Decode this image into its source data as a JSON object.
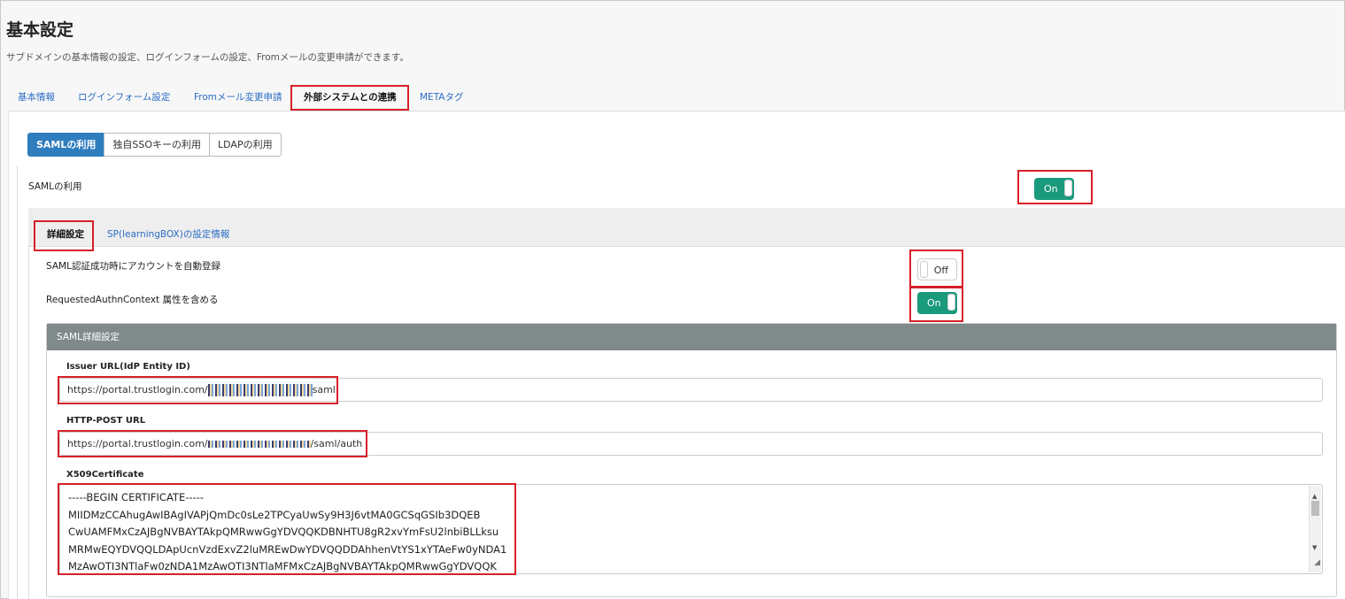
{
  "page": {
    "title": "基本設定",
    "description": "サブドメインの基本情報の設定、ログインフォームの設定、Fromメールの変更申請ができます。"
  },
  "main_tabs": [
    {
      "label": "基本情報",
      "active": false
    },
    {
      "label": "ログインフォーム設定",
      "active": false
    },
    {
      "label": "Fromメール変更申請",
      "active": false
    },
    {
      "label": "外部システムとの連携",
      "active": true
    },
    {
      "label": "METAタグ",
      "active": false
    }
  ],
  "sso_buttons": [
    {
      "label": "SAMLの利用",
      "active": true
    },
    {
      "label": "独自SSOキーの利用",
      "active": false
    },
    {
      "label": "LDAPの利用",
      "active": false
    }
  ],
  "saml_use": {
    "label": "SAMLの利用",
    "toggle": "On"
  },
  "sub_tabs": [
    {
      "label": "詳細設定",
      "active": true
    },
    {
      "label": "SP(learningBOX)の設定情報",
      "active": false
    }
  ],
  "auto_register": {
    "label": "SAML認証成功時にアカウントを自動登録",
    "toggle": "Off"
  },
  "requested_authn": {
    "label": "RequestedAuthnContext 属性を含める",
    "toggle": "On"
  },
  "saml_detail": {
    "heading": "SAML詳細設定",
    "issuer": {
      "label": "Issuer URL(IdP Entity ID)",
      "prefix": "https://portal.trustlogin.com/",
      "suffix": "saml"
    },
    "http_post": {
      "label": "HTTP-POST URL",
      "prefix": "https://portal.trustlogin.com/",
      "suffix": "/saml/auth"
    },
    "cert": {
      "label": "X509Certificate",
      "lines": [
        "-----BEGIN CERTIFICATE-----",
        "MIIDMzCCAhugAwIBAgIVAPjQmDc0sLe2TPCyaUwSy9H3J6vtMA0GCSqGSIb3DQEB",
        "CwUAMFMxCzAJBgNVBAYTAkpQMRwwGgYDVQQKDBNHTU8gR2xvYmFsU2lnbiBLLksu",
        "MRMwEQYDVQQLDApUcnVzdExvZ2luMREwDwYDVQQDDAhhenVtYS1xYTAeFw0yNDA1",
        "MzAwOTI3NTlaFw0zNDA1MzAwOTI3NTlaMFMxCzAJBgNVBAYTAkpQMRwwGgYDVQQK"
      ]
    }
  },
  "colors": {
    "accent": "#1a9a7c",
    "primary": "#2e7dbe",
    "highlight": "#d8202a",
    "panel_head": "#808a8a"
  }
}
